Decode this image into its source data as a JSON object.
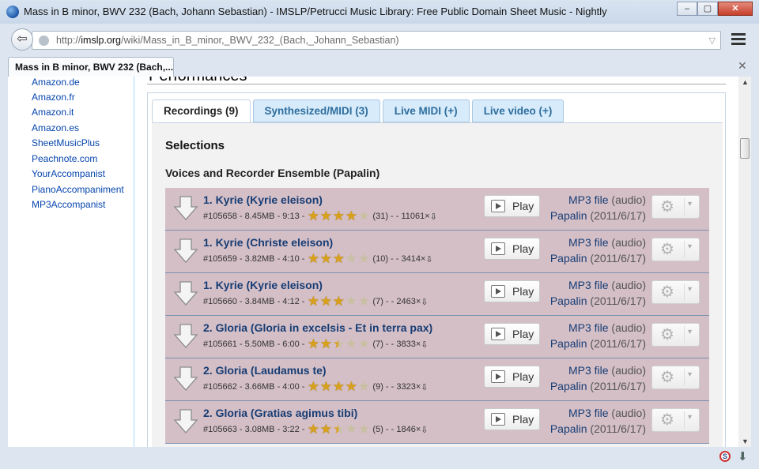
{
  "window": {
    "title": "Mass in B minor, BWV 232 (Bach, Johann Sebastian) - IMSLP/Petrucci Music Library: Free Public Domain Sheet Music - Nightly",
    "min": "‒",
    "restore": "▢",
    "close": "✕"
  },
  "nav": {
    "back": "⇦",
    "url_prefix": "http://",
    "url_host": "imslp.org",
    "url_path": "/wiki/Mass_in_B_minor,_BWV_232_(Bach,_Johann_Sebastian)",
    "url_drop": "▽"
  },
  "tab": {
    "label": "Mass in B minor, BWV 232 (Bach,...",
    "close": "✕"
  },
  "sidebar": {
    "links": [
      "Amazon.de",
      "Amazon.fr",
      "Amazon.it",
      "Amazon.es",
      "SheetMusicPlus",
      "Peachnote.com",
      "YourAccompanist",
      "PianoAccompaniment",
      "MP3Accompanist"
    ]
  },
  "main": {
    "performances_heading": "Performances",
    "tabs": [
      "Recordings (9)",
      "Synthesized/MIDI (3)",
      "Live MIDI (+)",
      "Live video (+)"
    ],
    "selections": "Selections",
    "ensemble": "Voices and Recorder Ensemble (Papalin)"
  },
  "play_label": "Play",
  "mp3_link": "MP3 file",
  "mp3_sub": "(audio)",
  "tracks": [
    {
      "title": "1. Kyrie (Kyrie eleison)",
      "meta": "#105658 - 8.45MB - 9:13 -",
      "rating": 4.0,
      "count": "(31) - - 11061×",
      "source": "Papalin",
      "date": "(2011/6/17)"
    },
    {
      "title": "1. Kyrie (Christe eleison)",
      "meta": "#105659 - 3.82MB - 4:10 -",
      "rating": 3.0,
      "count": "(10) - - 3414×",
      "source": "Papalin",
      "date": "(2011/6/17)"
    },
    {
      "title": "1. Kyrie (Kyrie eleison)",
      "meta": "#105660 - 3.84MB - 4:12 -",
      "rating": 3.0,
      "count": "(7) - - 2463×",
      "source": "Papalin",
      "date": "(2011/6/17)"
    },
    {
      "title": "2. Gloria (Gloria in excelsis - Et in terra pax)",
      "meta": "#105661 - 5.50MB - 6:00 -",
      "rating": 2.5,
      "count": "(7) - - 3833×",
      "source": "Papalin",
      "date": "(2011/6/17)"
    },
    {
      "title": "2. Gloria (Laudamus te)",
      "meta": "#105662 - 3.66MB - 4:00 -",
      "rating": 4.0,
      "count": "(9) - - 3323×",
      "source": "Papalin",
      "date": "(2011/6/17)"
    },
    {
      "title": "2. Gloria (Gratias agimus tibi)",
      "meta": "#105663 - 3.08MB - 3:22 -",
      "rating": 2.5,
      "count": "(5) - - 1846×",
      "source": "Papalin",
      "date": "(2011/6/17)"
    }
  ],
  "colors": {
    "row_bg": "#d4bfc7",
    "link": "#173d74",
    "tab_bg": "#d7ebfa"
  }
}
